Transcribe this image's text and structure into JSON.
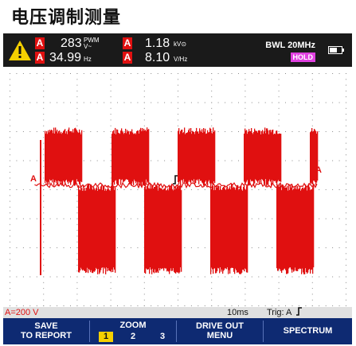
{
  "page_title": "电压调制测量",
  "topbar": {
    "channel_badge": "A",
    "readings": [
      {
        "value": "283",
        "unit": "PWM V~"
      },
      {
        "value": "34.99",
        "unit": "Hz"
      },
      {
        "value": "1.18",
        "unit": "kV⊙"
      },
      {
        "value": "8.10",
        "unit": "V/Hz"
      }
    ],
    "bandwidth_label": "BWL 20MHz",
    "hold_label": "HOLD"
  },
  "plot": {
    "left_marker": "A",
    "right_marker": "A",
    "trigger_marker": "T"
  },
  "statusbar": {
    "scale": "A=200 V",
    "timebase": "10ms",
    "trigger": "Trig: A",
    "trigger_icon": "rising-edge-icon"
  },
  "softkeys": {
    "save_line1": "SAVE",
    "save_line2": "TO REPORT",
    "zoom_label": "ZOOM",
    "zoom_options": [
      "1",
      "2",
      "3"
    ],
    "zoom_selected": "1",
    "drive_line1": "DRIVE OUT",
    "drive_line2": "MENU",
    "spectrum_label": "SPECTRUM"
  },
  "colors": {
    "trace": "#e01010",
    "softkey_bar": "#0e2a72",
    "hold_badge": "#e040e0",
    "zoom_highlight": "#f5d000"
  }
}
